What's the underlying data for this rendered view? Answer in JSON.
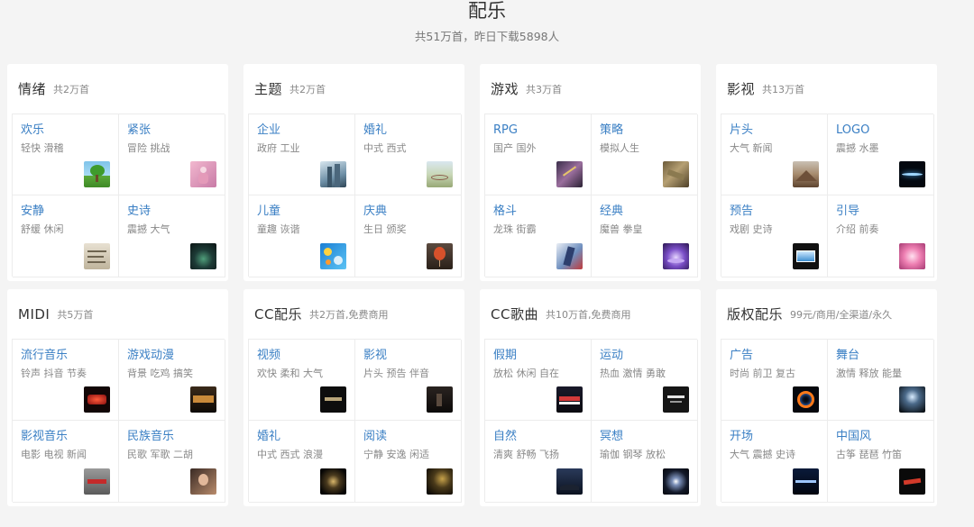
{
  "header": {
    "title": "配乐",
    "subtitle": "共51万首，昨日下载5898人"
  },
  "cards": [
    {
      "title": "情绪",
      "count": "共2万首",
      "tiles": [
        {
          "name": "欢乐",
          "tags": "轻快 滑稽",
          "thumb": "tree-icon"
        },
        {
          "name": "紧张",
          "tags": "冒险 挑战",
          "thumb": "figure-pink-icon"
        },
        {
          "name": "安静",
          "tags": "舒缓 休闲",
          "thumb": "paper-text-icon"
        },
        {
          "name": "史诗",
          "tags": "震撼 大气",
          "thumb": "dark-glow-icon"
        }
      ]
    },
    {
      "title": "主题",
      "count": "共2万首",
      "tiles": [
        {
          "name": "企业",
          "tags": "政府 工业",
          "thumb": "building-icon"
        },
        {
          "name": "婚礼",
          "tags": "中式 西式",
          "thumb": "landscape-icon"
        },
        {
          "name": "儿童",
          "tags": "童趣 诙谐",
          "thumb": "bubbles-icon"
        },
        {
          "name": "庆典",
          "tags": "生日 颁奖",
          "thumb": "balloon-icon"
        }
      ]
    },
    {
      "title": "游戏",
      "count": "共3万首",
      "tiles": [
        {
          "name": "RPG",
          "tags": "国产 国外",
          "thumb": "fantasy-icon"
        },
        {
          "name": "策略",
          "tags": "模拟人生",
          "thumb": "terrain-icon"
        },
        {
          "name": "格斗",
          "tags": "龙珠 街霸",
          "thumb": "fighter-icon"
        },
        {
          "name": "经典",
          "tags": "魔兽 拳皇",
          "thumb": "crystal-icon"
        }
      ]
    },
    {
      "title": "影视",
      "count": "共13万首",
      "tiles": [
        {
          "name": "片头",
          "tags": "大气 新闻",
          "thumb": "mountain-icon"
        },
        {
          "name": "LOGO",
          "tags": "震撼 水墨",
          "thumb": "light-streak-icon"
        },
        {
          "name": "预告",
          "tags": "戏剧 史诗",
          "thumb": "screen-icon"
        },
        {
          "name": "引导",
          "tags": "介绍 前奏",
          "thumb": "flower-icon"
        }
      ]
    },
    {
      "title": "MIDI",
      "count": "共5万首",
      "tiles": [
        {
          "name": "流行音乐",
          "tags": "铃声 抖音 节奏",
          "thumb": "stage-lights-icon"
        },
        {
          "name": "游戏动漫",
          "tags": "背景 吃鸡 搞笑",
          "thumb": "game-screen-icon"
        },
        {
          "name": "影视音乐",
          "tags": "电影 电视 新闻",
          "thumb": "film-logo-icon"
        },
        {
          "name": "民族音乐",
          "tags": "民歌 军歌 二胡",
          "thumb": "portrait-icon"
        }
      ]
    },
    {
      "title": "CC配乐",
      "count": "共2万首,免费商用",
      "tiles": [
        {
          "name": "视频",
          "tags": "欢快 柔和 大气",
          "thumb": "video-logo-icon"
        },
        {
          "name": "影视",
          "tags": "片头 预告 伴音",
          "thumb": "dark-scene-icon"
        },
        {
          "name": "婚礼",
          "tags": "中式 西式 浪漫",
          "thumb": "night-glow-icon"
        },
        {
          "name": "阅读",
          "tags": "宁静 安逸 闲适",
          "thumb": "reading-icon"
        }
      ]
    },
    {
      "title": "CC歌曲",
      "count": "共10万首,免费商用",
      "tiles": [
        {
          "name": "假期",
          "tags": "放松 休闲 自在",
          "thumb": "city-night-icon"
        },
        {
          "name": "运动",
          "tags": "热血 激情 勇敢",
          "thumb": "sport-logo-icon"
        },
        {
          "name": "自然",
          "tags": "清爽 舒畅 飞扬",
          "thumb": "starry-sky-icon"
        },
        {
          "name": "冥想",
          "tags": "瑜伽 钢琴 放松",
          "thumb": "galaxy-icon"
        }
      ]
    },
    {
      "title": "版权配乐",
      "count": "99元/商用/全渠道/永久",
      "tiles": [
        {
          "name": "广告",
          "tags": "时尚 前卫 复古",
          "thumb": "fire-ring-icon"
        },
        {
          "name": "舞台",
          "tags": "激情 释放 能量",
          "thumb": "spotlight-icon"
        },
        {
          "name": "开场",
          "tags": "大气 震撼 史诗",
          "thumb": "legends-icon"
        },
        {
          "name": "中国风",
          "tags": "古筝 琵琶 竹笛",
          "thumb": "calligraphy-icon"
        }
      ]
    }
  ],
  "colors": {
    "link": "#3a7fc4",
    "muted": "#888888",
    "background": "#f4f4f4"
  }
}
